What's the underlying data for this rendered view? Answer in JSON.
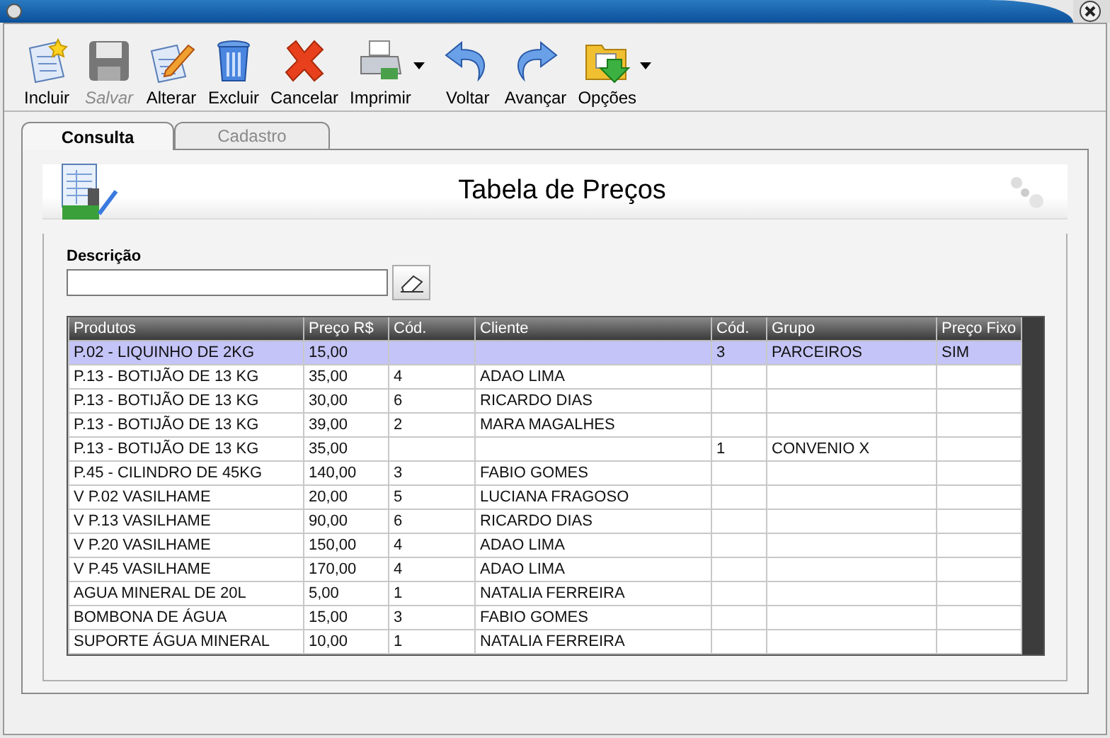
{
  "toolbar": [
    {
      "label": "Incluir",
      "disabled": false,
      "dropdown": false
    },
    {
      "label": "Salvar",
      "disabled": true,
      "dropdown": false
    },
    {
      "label": "Alterar",
      "disabled": false,
      "dropdown": false
    },
    {
      "label": "Excluir",
      "disabled": false,
      "dropdown": false
    },
    {
      "label": "Cancelar",
      "disabled": false,
      "dropdown": false
    },
    {
      "label": "Imprimir",
      "disabled": false,
      "dropdown": true
    },
    {
      "label": "Voltar",
      "disabled": false,
      "dropdown": false
    },
    {
      "label": "Avançar",
      "disabled": false,
      "dropdown": false
    },
    {
      "label": "Opções",
      "disabled": false,
      "dropdown": true
    }
  ],
  "tabs": [
    {
      "label": "Consulta",
      "selected": true
    },
    {
      "label": "Cadastro",
      "selected": false
    }
  ],
  "header": {
    "title": "Tabela de Preços"
  },
  "search": {
    "label": "Descrição"
  },
  "table": {
    "columns": [
      "Produtos",
      "Preço R$",
      "Cód.",
      "Cliente",
      "Cód.",
      "Grupo",
      "Preço Fixo"
    ],
    "rows": [
      {
        "cells": [
          "P.02 - LIQUINHO DE 2KG",
          "15,00",
          "",
          "",
          "3",
          "PARCEIROS",
          "SIM"
        ],
        "selected": true
      },
      {
        "cells": [
          "P.13 - BOTIJÃO DE 13 KG",
          "35,00",
          "4",
          "ADAO LIMA",
          "",
          "",
          ""
        ],
        "selected": false
      },
      {
        "cells": [
          "P.13 - BOTIJÃO DE 13 KG",
          "30,00",
          "6",
          "RICARDO DIAS",
          "",
          "",
          ""
        ],
        "selected": false
      },
      {
        "cells": [
          "P.13 - BOTIJÃO DE 13 KG",
          "39,00",
          "2",
          "MARA MAGALHES",
          "",
          "",
          ""
        ],
        "selected": false
      },
      {
        "cells": [
          "P.13 - BOTIJÃO DE 13 KG",
          "35,00",
          "",
          "",
          "1",
          "CONVENIO X",
          ""
        ],
        "selected": false
      },
      {
        "cells": [
          "P.45 - CILINDRO DE 45KG",
          "140,00",
          "3",
          "FABIO GOMES",
          "",
          "",
          ""
        ],
        "selected": false
      },
      {
        "cells": [
          "V P.02 VASILHAME",
          "20,00",
          "5",
          "LUCIANA FRAGOSO",
          "",
          "",
          ""
        ],
        "selected": false
      },
      {
        "cells": [
          "V P.13 VASILHAME",
          "90,00",
          "6",
          "RICARDO DIAS",
          "",
          "",
          ""
        ],
        "selected": false
      },
      {
        "cells": [
          "V P.20 VASILHAME",
          "150,00",
          "4",
          "ADAO LIMA",
          "",
          "",
          ""
        ],
        "selected": false
      },
      {
        "cells": [
          "V P.45 VASILHAME",
          "170,00",
          "4",
          "ADAO LIMA",
          "",
          "",
          ""
        ],
        "selected": false
      },
      {
        "cells": [
          "AGUA MINERAL DE 20L",
          "5,00",
          "1",
          "NATALIA FERREIRA",
          "",
          "",
          ""
        ],
        "selected": false
      },
      {
        "cells": [
          "BOMBONA DE ÁGUA",
          "15,00",
          "3",
          "FABIO GOMES",
          "",
          "",
          ""
        ],
        "selected": false
      },
      {
        "cells": [
          "SUPORTE ÁGUA MINERAL",
          "10,00",
          "1",
          "NATALIA FERREIRA",
          "",
          "",
          ""
        ],
        "selected": false
      }
    ]
  }
}
